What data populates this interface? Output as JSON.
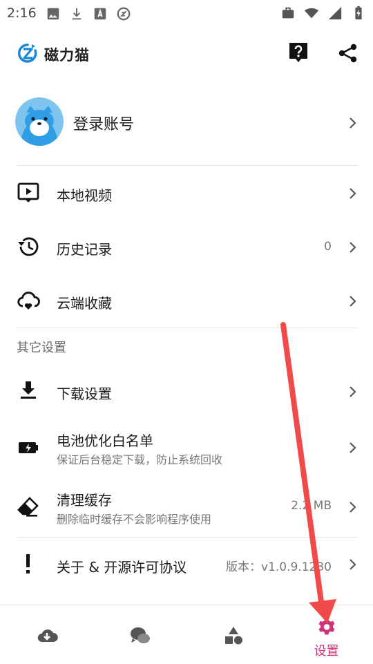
{
  "status_bar": {
    "time": "2:16"
  },
  "header": {
    "app_title": "磁力猫"
  },
  "account": {
    "label": "登录账号"
  },
  "rows": {
    "local_videos": {
      "title": "本地视频"
    },
    "history": {
      "title": "历史记录",
      "value": "0"
    },
    "cloud_favorites": {
      "title": "云端收藏"
    },
    "section_title": "其它设置",
    "download_settings": {
      "title": "下载设置"
    },
    "battery": {
      "title": "电池优化白名单",
      "subtitle": "保证后台稳定下载，防止系统回收"
    },
    "clear_cache": {
      "title": "清理缓存",
      "subtitle": "删除临时缓存不会影响程序使用",
      "value": "2.2 MB"
    },
    "about": {
      "title": "关于 & 开源许可协议",
      "value": "版本：v1.0.9.1230"
    }
  },
  "bottom_nav": {
    "settings_label": "设置"
  },
  "colors": {
    "accent": "#d0357a",
    "arrow": "#f04a4a",
    "logo": "#1e88d8"
  }
}
